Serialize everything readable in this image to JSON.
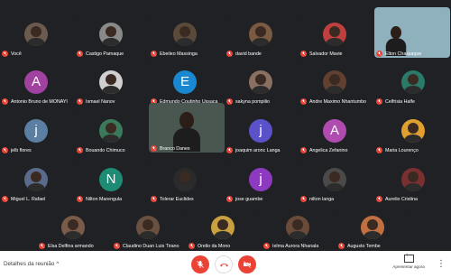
{
  "participants": [
    {
      "name": "Você",
      "avatar": "photo",
      "avatar_color": "#6b5a4e"
    },
    {
      "name": "Castigo Pamaque",
      "avatar": "photo",
      "avatar_color": "#8a8a8a"
    },
    {
      "name": "Ebeileo Massinga",
      "avatar": "photo",
      "avatar_color": "#5a4a3a"
    },
    {
      "name": "david bande",
      "avatar": "photo",
      "avatar_color": "#7a5a40"
    },
    {
      "name": "Salvador Mavie",
      "avatar": "photo",
      "avatar_color": "#c04040"
    },
    {
      "name": "Elton Chassaque",
      "avatar": "video",
      "avatar_color": "#a8c8d8"
    },
    {
      "name": "Antonio Bruno de MONAYI",
      "letter": "A",
      "avatar_color": "#a142a0"
    },
    {
      "name": "Ismael Nanov",
      "avatar": "photo",
      "avatar_color": "#d0d0d0"
    },
    {
      "name": "Edmundo Coutinho Ussaca",
      "letter": "E",
      "avatar_color": "#1a88d0"
    },
    {
      "name": "sakyna pompilio",
      "avatar": "photo",
      "avatar_color": "#8a7060"
    },
    {
      "name": "Andre Maximo Nhantumbo",
      "avatar": "photo",
      "avatar_color": "#604030"
    },
    {
      "name": "Celfrisia Halfe",
      "avatar": "photo",
      "avatar_color": "#2a7a6a"
    },
    {
      "name": "jelb flores",
      "letter": "j",
      "avatar_color": "#5b7fa3"
    },
    {
      "name": "Bouando Chimuco",
      "avatar": "photo",
      "avatar_color": "#3a7a5a"
    },
    {
      "name": "Branco Danes",
      "avatar": "video",
      "avatar_color": "#4a5650"
    },
    {
      "name": "joaquim aronc Langa",
      "letter": "j",
      "avatar_color": "#5b52c9"
    },
    {
      "name": "Angelica Zefanino",
      "letter": "A",
      "avatar_color": "#b04bb0"
    },
    {
      "name": "Maria Lourenço",
      "avatar": "photo",
      "avatar_color": "#e0a030"
    },
    {
      "name": "Miguel L. Rafael",
      "avatar": "photo",
      "avatar_color": "#5a6a8a"
    },
    {
      "name": "Nilton Marengula",
      "letter": "N",
      "avatar_color": "#1e8c74"
    },
    {
      "name": "Tolerar Euclides",
      "avatar": "photo",
      "avatar_color": "#2a2a2a"
    },
    {
      "name": "jose guambe",
      "letter": "j",
      "avatar_color": "#8e3ac0"
    },
    {
      "name": "nilton langa",
      "avatar": "photo",
      "avatar_color": "#4a4a4a"
    },
    {
      "name": "Aurelio Cristina",
      "avatar": "photo",
      "avatar_color": "#7a3030"
    },
    {
      "name": "Elsa Delfina armando",
      "avatar": "photo",
      "avatar_color": "#7a5a48"
    },
    {
      "name": "Claudino Duan Luis Tirano",
      "avatar": "photo",
      "avatar_color": "#6a5040"
    },
    {
      "name": "Orelio da Mono",
      "avatar": "photo",
      "avatar_color": "#c8a040"
    },
    {
      "name": "Ielma Aurora Nhanala",
      "avatar": "photo",
      "avatar_color": "#6a4a38"
    },
    {
      "name": "Augusto Tembe",
      "avatar": "photo",
      "avatar_color": "#c07040"
    }
  ],
  "bottom_bar": {
    "meeting_details": "Detalhes da reunião",
    "chevron": "^",
    "present_now": "Apresentar agora",
    "more_options": "⋮",
    "colors": {
      "end_call": "#ea4335",
      "mic_off": "#ea4335",
      "cam_off": "#ea4335"
    }
  }
}
